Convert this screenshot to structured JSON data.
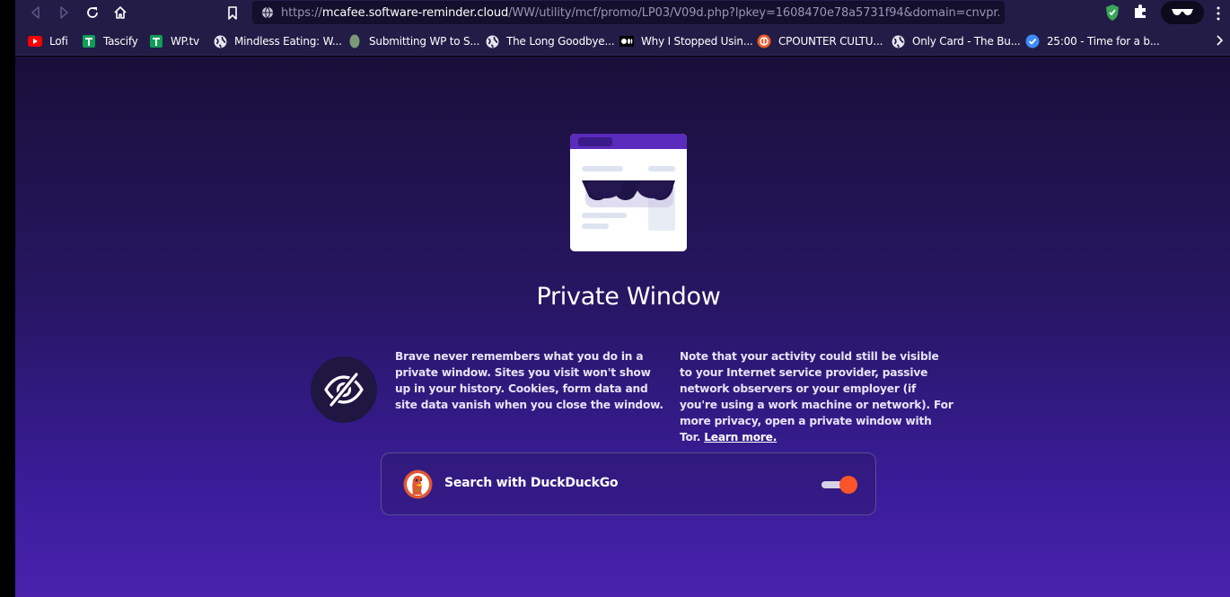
{
  "browser": {
    "url_scheme": "https://",
    "url_host": "mcafee.software-reminder.cloud",
    "url_path": "/WW/utility/mcf/promo/LP03/V09d.php?lpkey=1608470e78a5731f94&domain=cnvpr...",
    "bookmarks": [
      {
        "label": "Lofi",
        "icon": "youtube-icon",
        "color": "#ff0000"
      },
      {
        "label": "Tascify",
        "icon": "sheets-icon",
        "color": "#0f9d58"
      },
      {
        "label": "WP.tv",
        "icon": "sheets-icon",
        "color": "#0f9d58"
      },
      {
        "label": "Mindless Eating: W...",
        "icon": "globe-icon"
      },
      {
        "label": "Submitting WP to S...",
        "icon": "leaf-icon",
        "color": "#7a9a7a"
      },
      {
        "label": "The Long Goodbye...",
        "icon": "globe-icon"
      },
      {
        "label": "Why I Stopped Usin...",
        "icon": "medium-icon"
      },
      {
        "label": "CPOUNTER CULTU...",
        "icon": "orange-circle-icon",
        "color": "#f05a28"
      },
      {
        "label": "Only Card - The Bu...",
        "icon": "globe-icon"
      },
      {
        "label": "25:00 - Time for a b...",
        "icon": "check-circle-icon",
        "color": "#3d8bfd"
      }
    ]
  },
  "page": {
    "title": "Private Window",
    "para1": "Brave never remembers what you do in a private window. Sites you visit won't show up in your history. Cookies, form data and site data vanish when you close the window.",
    "para2": "Note that your activity could still be visible to your Internet service provider, passive network observers or your employer (if you're using a work machine or network). For more privacy, open a private window with Tor.",
    "learn_more": "Learn more.",
    "search_label": "Search with DuckDuckGo",
    "search_toggle_on": true
  },
  "colors": {
    "accent": "#fb542b",
    "toolbar": "#231c47",
    "background_top": "#1a0f3a",
    "background_bottom": "#4a22ad"
  }
}
